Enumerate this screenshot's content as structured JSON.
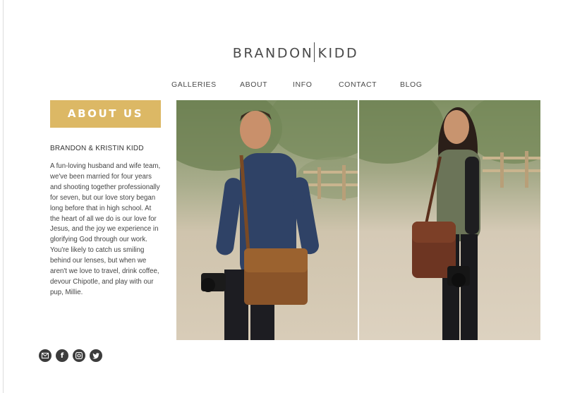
{
  "brand": {
    "first": "BRANDON",
    "last": "KIDD"
  },
  "nav": {
    "items": [
      {
        "label": "GALLERIES"
      },
      {
        "label": "ABOUT"
      },
      {
        "label": "INFO"
      },
      {
        "label": "CONTACT"
      },
      {
        "label": "BLOG"
      }
    ]
  },
  "about": {
    "banner": "ABOUT US",
    "names": "BRANDON & KRISTIN KIDD",
    "bio": "A fun-loving husband and wife team, we've been married for four years and shooting together professionally for seven, but our love story began long before that in high school. At the heart of all we do is our love for Jesus, and the joy we experience in glorifying God through our work. You're likely to catch us smiling behind our lenses, but when we aren't we love to travel, drink coffee, devour Chipotle, and play with our pup, Millie."
  },
  "photos": [
    {
      "subject": "man-with-camera-and-brown-bag"
    },
    {
      "subject": "woman-with-camera-and-brown-bag"
    }
  ],
  "social": [
    {
      "icon": "email-icon"
    },
    {
      "icon": "facebook-icon",
      "glyph": "f"
    },
    {
      "icon": "instagram-icon"
    },
    {
      "icon": "twitter-icon"
    }
  ],
  "colors": {
    "accent": "#dcb865",
    "text": "#3a3a3a",
    "social_bg": "#3c3c3c"
  }
}
